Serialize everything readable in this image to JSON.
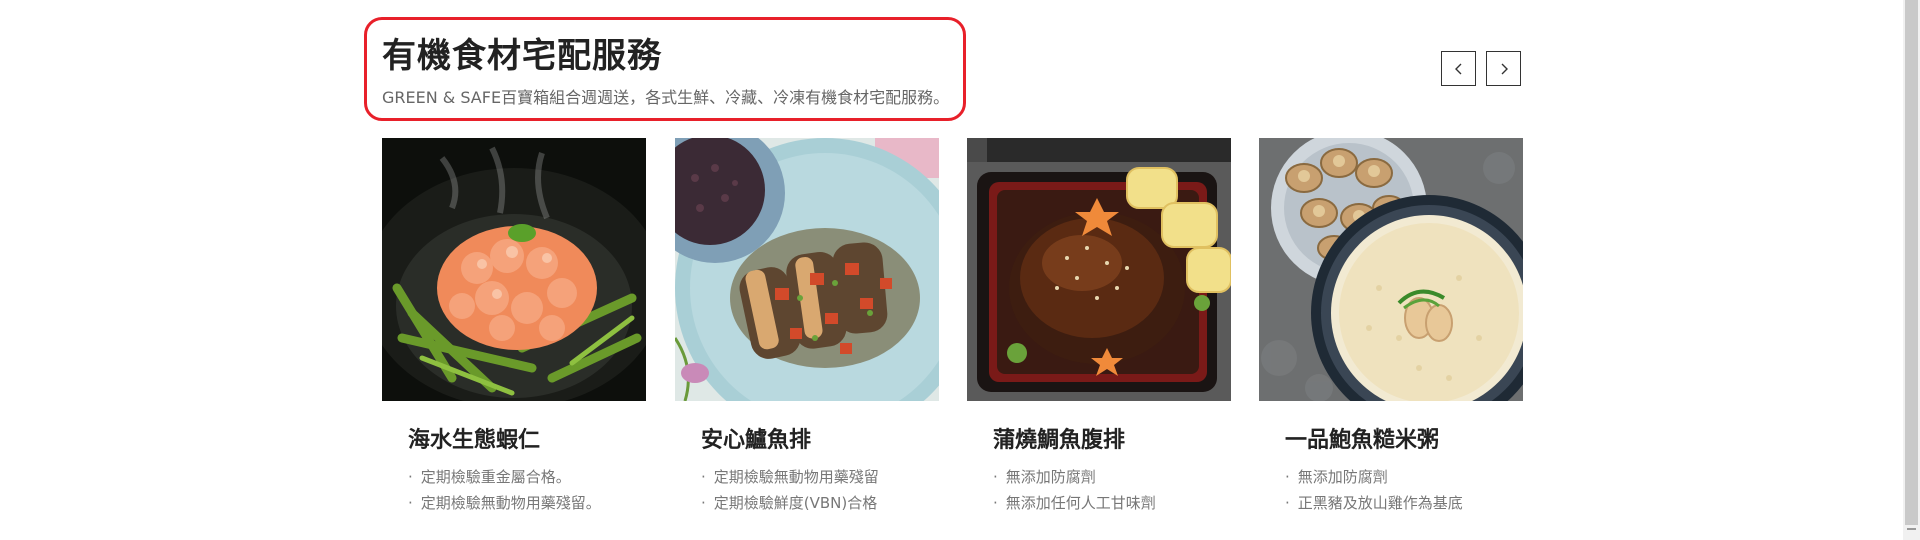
{
  "section": {
    "title": "有機食材宅配服務",
    "subtitle": "GREEN & SAFE百寶箱組合週週送，各式生鮮、冷藏、冷凍有機食材宅配服務。"
  },
  "nav": {
    "prev_icon": "chevron-left-icon",
    "next_icon": "chevron-right-icon"
  },
  "products": [
    {
      "name": "海水生態蝦仁",
      "image": "shrimp-asparagus-photo",
      "features": [
        "定期檢驗重金屬合格。",
        "定期檢驗無動物用藥殘留。"
      ]
    },
    {
      "name": "安心鱸魚排",
      "image": "sea-bass-fillet-photo",
      "features": [
        "定期檢驗無動物用藥殘留",
        "定期檢驗鮮度(VBN)合格"
      ]
    },
    {
      "name": "蒲燒鯛魚腹排",
      "image": "kabayaki-fish-bento-photo",
      "features": [
        "無添加防腐劑",
        "無添加任何人工甘味劑"
      ]
    },
    {
      "name": "一品鮑魚糙米粥",
      "image": "abalone-rice-porridge-photo",
      "features": [
        "無添加防腐劑",
        "正黑豬及放山雞作為基底"
      ]
    }
  ],
  "colors": {
    "highlight": "#e8202a",
    "title": "#222222",
    "muted": "#777777"
  }
}
